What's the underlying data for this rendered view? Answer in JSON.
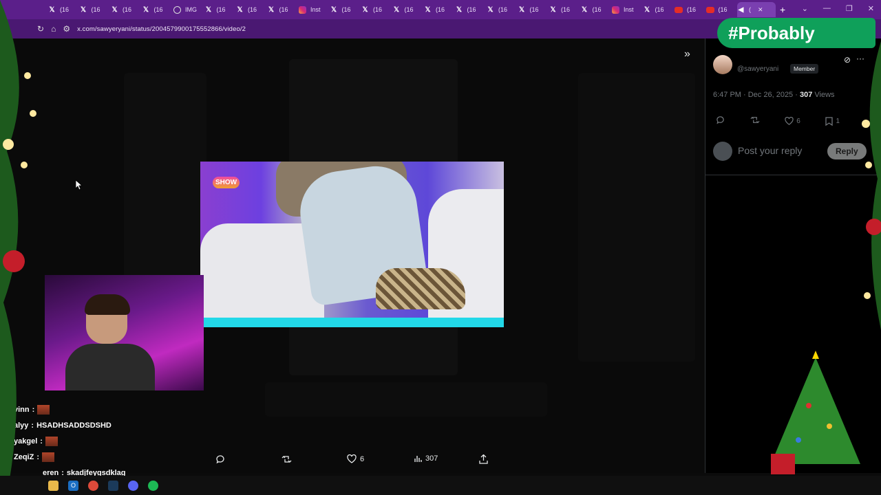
{
  "browser": {
    "tabs": [
      {
        "icon": "x-icon",
        "label": "(16"
      },
      {
        "icon": "x-icon",
        "label": "(16"
      },
      {
        "icon": "x-icon",
        "label": "(16"
      },
      {
        "icon": "x-icon",
        "label": "(16"
      },
      {
        "icon": "web-icon",
        "label": "IMG"
      },
      {
        "icon": "x-icon",
        "label": "(16"
      },
      {
        "icon": "x-icon",
        "label": "(16"
      },
      {
        "icon": "x-icon",
        "label": "(16"
      },
      {
        "icon": "instagram-icon",
        "label": "Inst"
      },
      {
        "icon": "x-icon",
        "label": "(16"
      },
      {
        "icon": "x-icon",
        "label": "(16"
      },
      {
        "icon": "x-icon",
        "label": "(16"
      },
      {
        "icon": "x-icon",
        "label": "(16"
      },
      {
        "icon": "x-icon",
        "label": "(16"
      },
      {
        "icon": "x-icon",
        "label": "(16"
      },
      {
        "icon": "x-icon",
        "label": "(16"
      },
      {
        "icon": "x-icon",
        "label": "(16"
      },
      {
        "icon": "x-icon",
        "label": "(16"
      },
      {
        "icon": "instagram-icon",
        "label": "Inst"
      },
      {
        "icon": "x-icon",
        "label": "(16"
      },
      {
        "icon": "youtube-icon",
        "label": "(16"
      },
      {
        "icon": "youtube-icon",
        "label": "(16"
      }
    ],
    "active_tab_label": "(",
    "url": "x.com/sawyeryani/status/2004579900175552866/video/2"
  },
  "post": {
    "handle": "@sawyeryani",
    "badge": "Member",
    "time": "6:47 PM · Dec 26, 2025 · ",
    "views_count": "307",
    "views_label": " Views",
    "likes": "6",
    "bookmarks": "1",
    "reply_placeholder": "Post your reply",
    "reply_button": "Reply"
  },
  "video_actions": {
    "likes": "6",
    "views": "307"
  },
  "overlay": {
    "brand": "#Probably",
    "video_logo": "SHOW"
  },
  "chat": [
    {
      "user": "vinn",
      "text": ""
    },
    {
      "user": "alyy",
      "text": "HSADHSADDSDSHD"
    },
    {
      "user": "yakgel",
      "text": ""
    },
    {
      "user": "ZeqiZ",
      "text": ""
    },
    {
      "user": "eren",
      "text": "skadjfeygsdklag"
    }
  ],
  "colors": {
    "browser_frame": "#5b1f8a",
    "accent_green": "#0fa05a",
    "text": "#e7e9ea",
    "muted": "#71767b"
  }
}
